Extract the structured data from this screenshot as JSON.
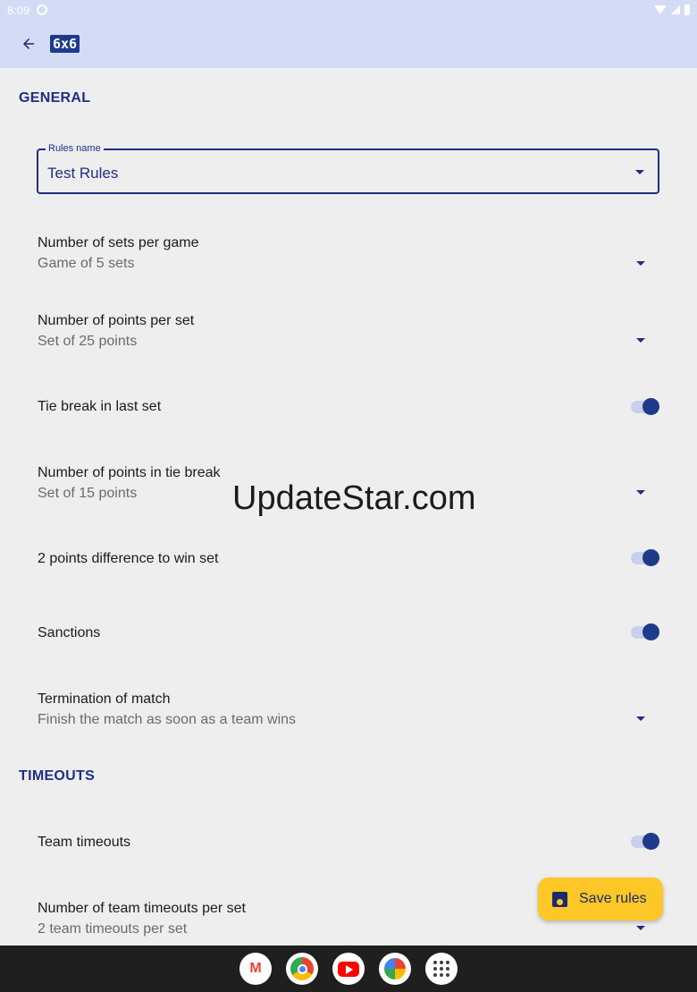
{
  "status_bar": {
    "time": "8:09",
    "icons": [
      "settings-icon",
      "wifi-icon",
      "signal-icon",
      "battery-icon"
    ]
  },
  "app_bar": {
    "back_icon": "arrow-back-icon",
    "logo_text": "6x6"
  },
  "sections": {
    "general": "GENERAL",
    "timeouts": "TIMEOUTS"
  },
  "rules_name": {
    "label": "Rules name",
    "value": "Test Rules"
  },
  "settings": {
    "sets_per_game": {
      "title": "Number of sets per game",
      "value": "Game of 5 sets"
    },
    "points_per_set": {
      "title": "Number of points per set",
      "value": "Set of 25 points"
    },
    "tie_break": {
      "title": "Tie break in last set",
      "enabled": true
    },
    "points_tie_break": {
      "title": "Number of points in tie break",
      "value": "Set of 15 points"
    },
    "two_points_diff": {
      "title": "2 points difference to win set",
      "enabled": true
    },
    "sanctions": {
      "title": "Sanctions",
      "enabled": true
    },
    "termination": {
      "title": "Termination of match",
      "value": "Finish the match as soon as a team wins"
    },
    "team_timeouts": {
      "title": "Team timeouts",
      "enabled": true
    },
    "timeouts_per_set": {
      "title": "Number of team timeouts per set",
      "value": "2 team timeouts per set"
    }
  },
  "watermark": "UpdateStar.com",
  "fab": {
    "icon": "save-icon",
    "label": "Save rules"
  },
  "dock": {
    "gmail_glyph": "M",
    "apps": [
      "gmail-icon",
      "chrome-icon",
      "youtube-icon",
      "photos-icon",
      "apps-grid-icon"
    ]
  },
  "colors": {
    "accent": "#1e2f86",
    "app_bar": "#d3dcf5",
    "fab": "#fcc727",
    "background": "#eeeeee"
  }
}
